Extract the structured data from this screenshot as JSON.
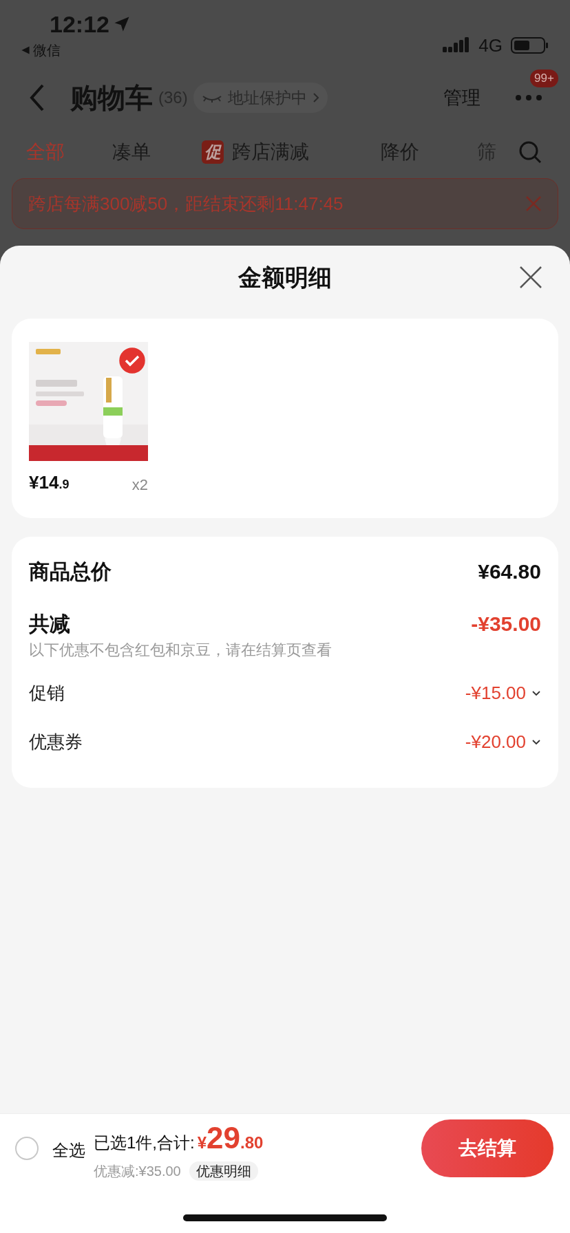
{
  "status_bar": {
    "time": "12:12",
    "back_app": "微信",
    "network": "4G"
  },
  "header": {
    "title": "购物车",
    "count": "(36)",
    "address_badge": "地址保护中",
    "manage": "管理",
    "more_badge": "99+"
  },
  "tabs": [
    {
      "label": "全部",
      "selected": true,
      "kind": "plain"
    },
    {
      "label": "凑单",
      "selected": false,
      "kind": "plain"
    },
    {
      "label": "跨店满减",
      "selected": false,
      "kind": "promo",
      "badge": "促"
    },
    {
      "label": "降价",
      "selected": false,
      "kind": "plain"
    },
    {
      "label": "筛",
      "selected": false,
      "kind": "plain"
    }
  ],
  "banner": {
    "text": "跨店每满300减50，距结束还剩11:47:45"
  },
  "sheet": {
    "title": "金额明细",
    "items": [
      {
        "kind": "picture",
        "checked": true,
        "price": "¥14",
        "price_decimal": ".9",
        "quantity": "x2"
      }
    ],
    "total": {
      "label": "商品总价",
      "value": "¥64.80"
    },
    "discount": {
      "label": "共减",
      "value": "-¥35.00",
      "note": "以下优惠不包含红包和京豆，请在结算页查看"
    },
    "details": [
      {
        "label": "促销",
        "value": "-¥15.00",
        "expanded": false
      },
      {
        "label": "优惠券",
        "value": "-¥20.00",
        "expanded": false
      }
    ]
  },
  "bottom_bar": {
    "select_all": {
      "label": "全选",
      "checked": false
    },
    "selected_text": "已选1件,合计:",
    "currency": "¥",
    "total": "29",
    "total_decimal": ".80",
    "discount_text": "优惠减:¥35.00",
    "detail_button": "优惠明细",
    "checkout": "去结算"
  }
}
